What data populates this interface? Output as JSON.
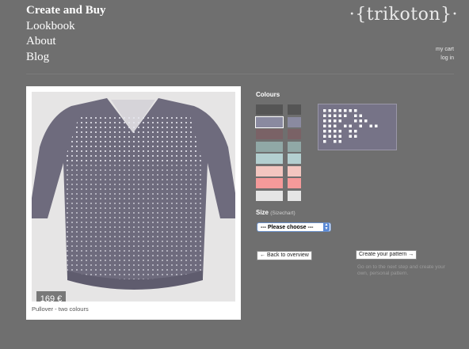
{
  "nav": {
    "items": [
      "Create and Buy",
      "Lookbook",
      "About",
      "Blog"
    ],
    "active": 0
  },
  "brand": {
    "logo": "·{trikoton}·"
  },
  "user_menu": {
    "cart": "my cart",
    "login": "log in"
  },
  "product": {
    "price": "169 €",
    "name": "Pullover - two colours",
    "colors": {
      "body": "#6e6b7d",
      "dots": "#e8e8f0",
      "bg": "#e6e5e5"
    }
  },
  "colours": {
    "label": "Colours",
    "primary": [
      "#555555",
      "#8a8aa0",
      "#7a6266",
      "#90a8a6",
      "#b3cfd0",
      "#f3c6c0",
      "#f59a9a",
      "#e5e5e5"
    ],
    "secondary": [
      "#555555",
      "#8a8aa0",
      "#7a6266",
      "#90a8a6",
      "#b3cfd0",
      "#f3c6c0",
      "#f59a9a",
      "#e5e5e5"
    ],
    "selected_index": 1
  },
  "size": {
    "label": "Size",
    "sizechart": "(Sizechart)",
    "select_value": "--- Please choose ---"
  },
  "actions": {
    "back": "← Back to overview",
    "create": "Create your pattern →",
    "hint": "Go on to the next step and create your own, personal pattern."
  }
}
